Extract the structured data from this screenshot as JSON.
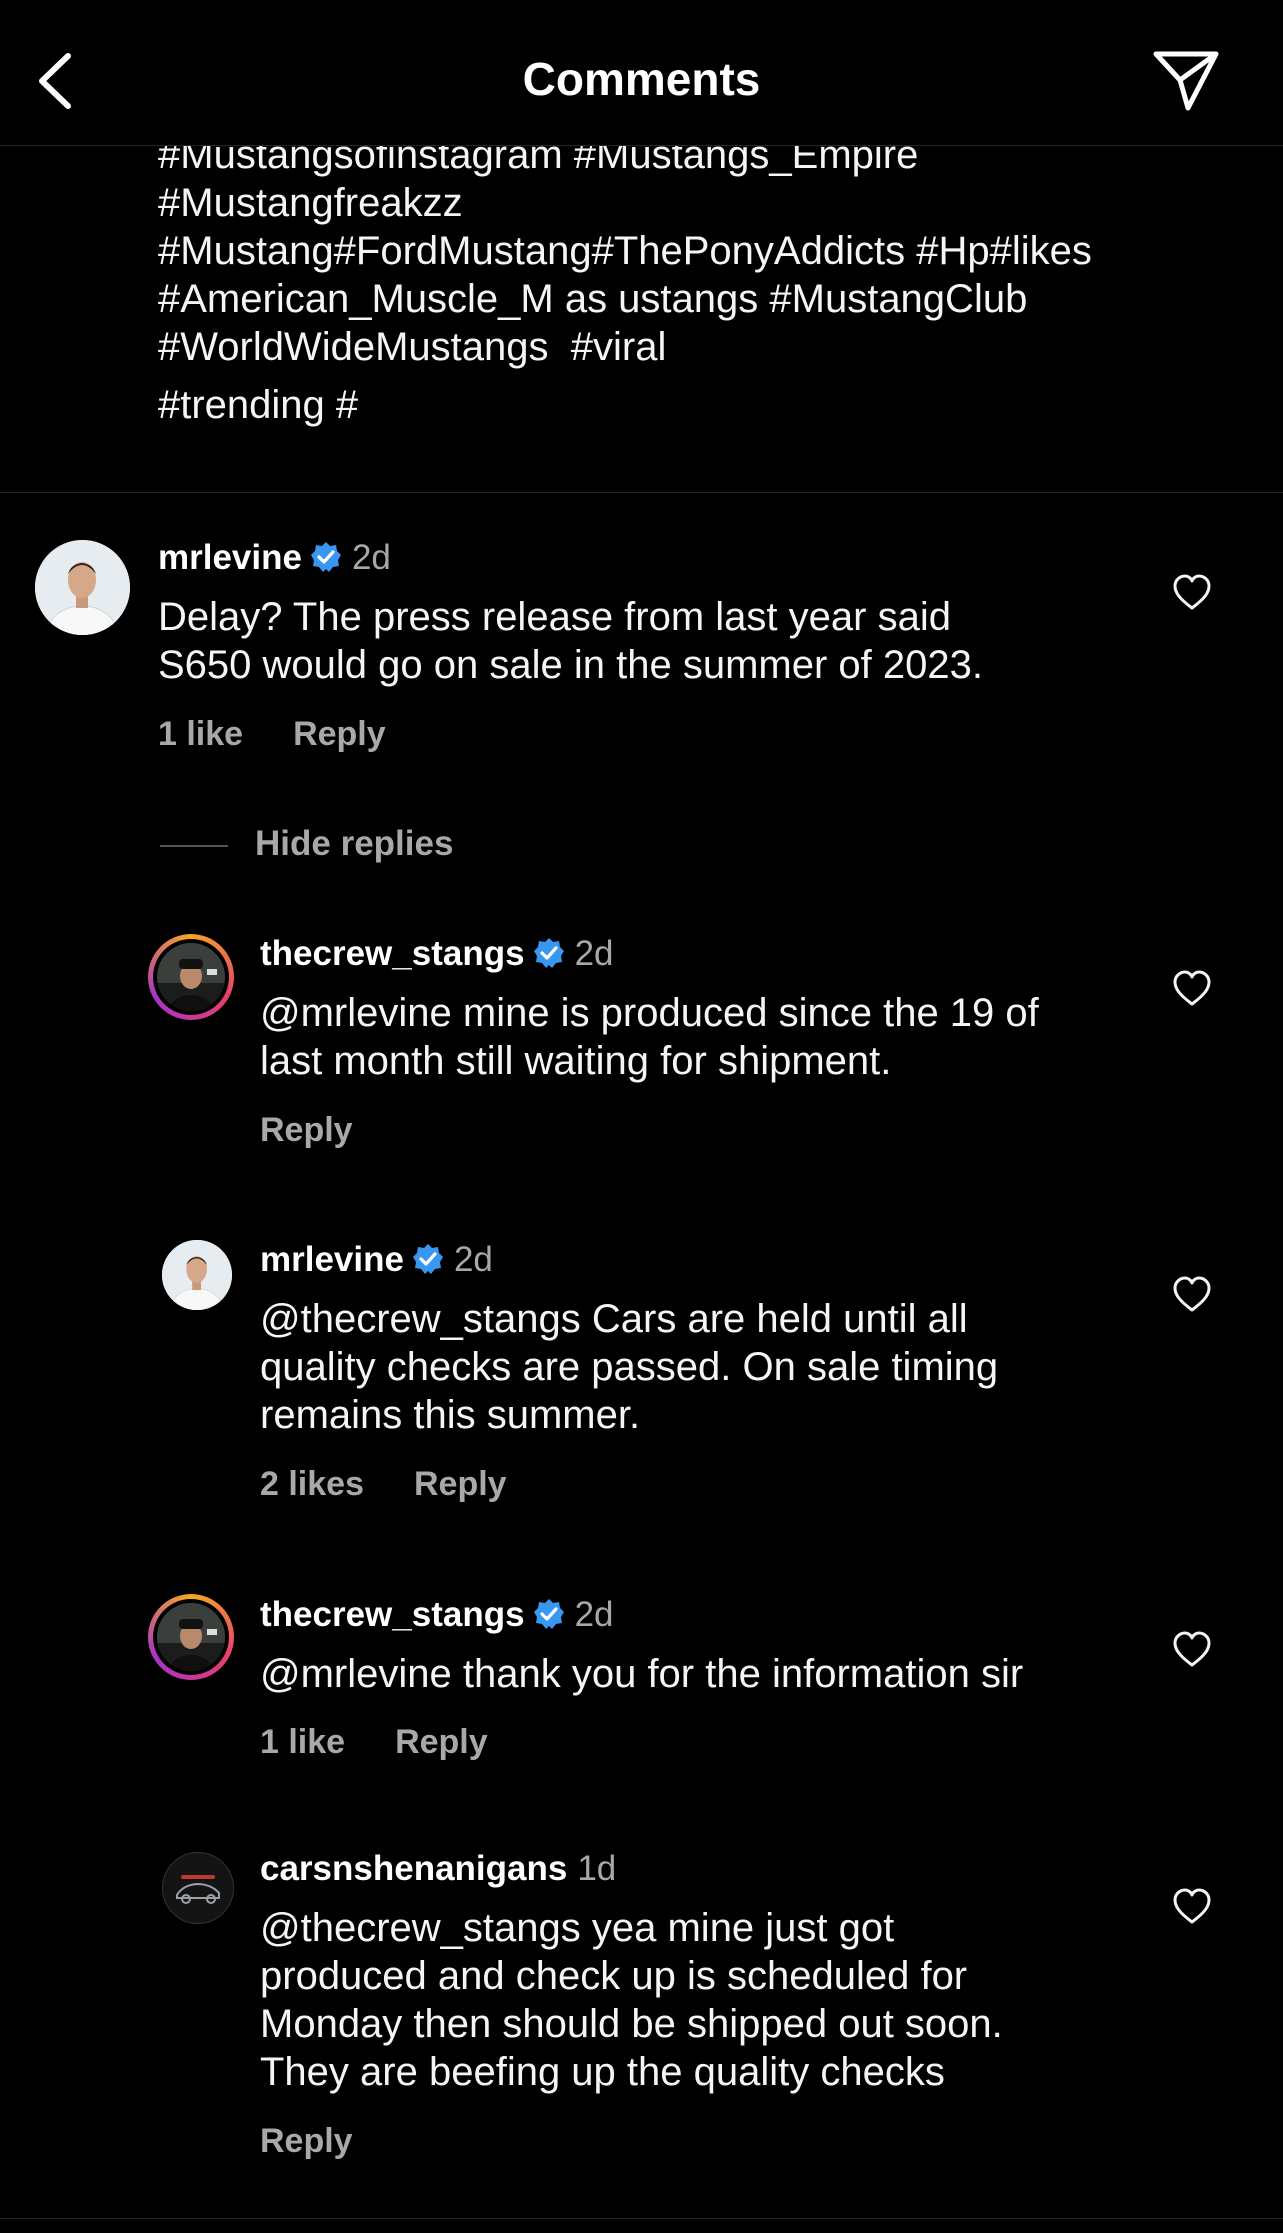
{
  "header": {
    "title": "Comments"
  },
  "caption": {
    "lines": [
      "#Mustangsofinstagram #Mustangs_Empire",
      "#Mustangfreakzz",
      "#Mustang#FordMustang#ThePonyAddicts #Hp#likes",
      "#American_Muscle_M as ustangs #MustangClub",
      "#WorldWideMustangs  #viral",
      "#trending #"
    ]
  },
  "colors": {
    "verified": "#3897f0",
    "secondary_text": "#a8a8a8",
    "background": "#000000"
  },
  "comments": [
    {
      "username": "mrlevine",
      "verified": true,
      "time": "2d",
      "text_lines": [
        "Delay? The press release from last year said",
        "S650 would go on sale in the summer of 2023."
      ],
      "likes": "1 like",
      "reply": "Reply"
    },
    {
      "username": "thecrew_stangs",
      "verified": true,
      "time": "2d",
      "text_lines": [
        "@mrlevine mine is produced since the 19 of",
        "last month still waiting for shipment."
      ],
      "reply": "Reply"
    },
    {
      "username": "mrlevine",
      "verified": true,
      "time": "2d",
      "text_lines": [
        "@thecrew_stangs Cars are held until all",
        "quality checks are passed. On sale timing",
        "remains this summer."
      ],
      "likes": "2 likes",
      "reply": "Reply"
    },
    {
      "username": "thecrew_stangs",
      "verified": true,
      "time": "2d",
      "text_lines": [
        "@mrlevine thank you for the information sir"
      ],
      "likes": "1 like",
      "reply": "Reply"
    },
    {
      "username": "carsnshenanigans",
      "verified": false,
      "time": "1d",
      "text_lines": [
        "@thecrew_stangs yea mine just got",
        "produced and check up is scheduled for",
        "Monday then should be shipped out soon.",
        "They are beefing up the quality checks"
      ],
      "reply": "Reply"
    }
  ],
  "hide_replies": "Hide replies",
  "icons": {
    "back": "chevron-left-icon",
    "send": "paper-plane-icon",
    "like": "heart-outline-icon",
    "verified": "verified-badge-icon"
  }
}
